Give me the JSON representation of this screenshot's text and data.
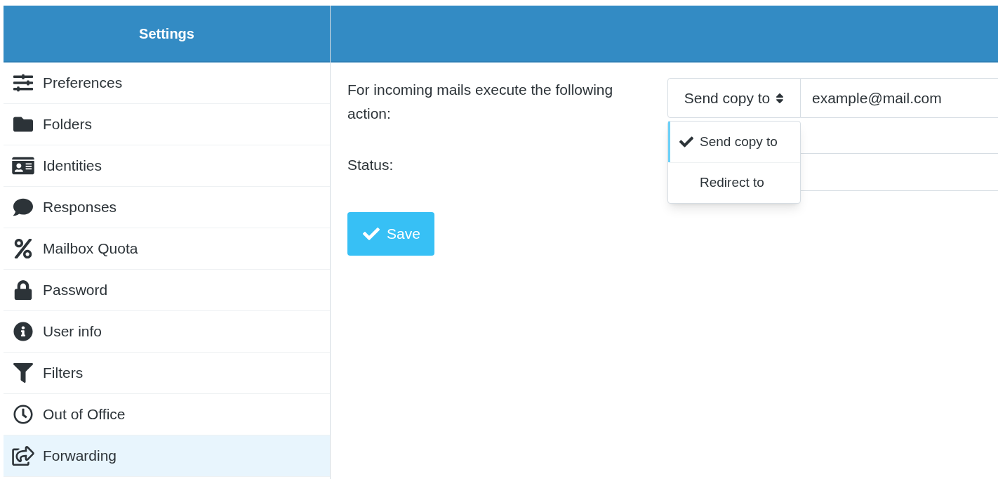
{
  "sidebar": {
    "title": "Settings",
    "items": [
      {
        "label": "Preferences",
        "selected": false
      },
      {
        "label": "Folders",
        "selected": false
      },
      {
        "label": "Identities",
        "selected": false
      },
      {
        "label": "Responses",
        "selected": false
      },
      {
        "label": "Mailbox Quota",
        "selected": false
      },
      {
        "label": "Password",
        "selected": false
      },
      {
        "label": "User info",
        "selected": false
      },
      {
        "label": "Filters",
        "selected": false
      },
      {
        "label": "Out of Office",
        "selected": false
      },
      {
        "label": "Forwarding",
        "selected": true
      }
    ]
  },
  "form": {
    "action_label": "For incoming mails execute the following action:",
    "action_select": "Send copy to",
    "address": "example@mail.com",
    "status_label": "Status:",
    "dropdown": [
      {
        "label": "Send copy to",
        "selected": true
      },
      {
        "label": "Redirect to",
        "selected": false
      }
    ],
    "save_button": "Save"
  }
}
